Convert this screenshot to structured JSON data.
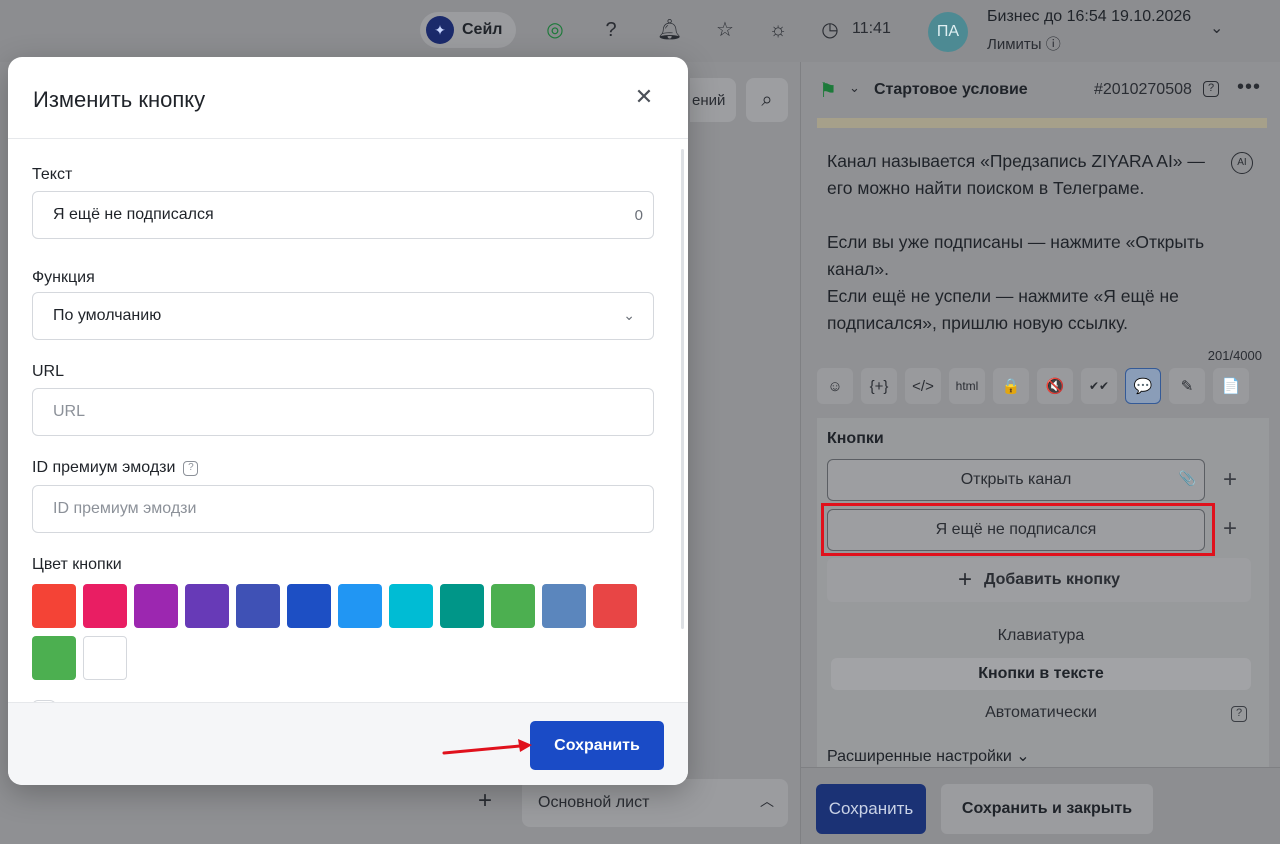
{
  "topbar": {
    "sale_label": "Сейл",
    "time": "11:41",
    "avatar_initials": "ПА",
    "business": "Бизнес до 16:54 19.10.2026",
    "limits": "Лимиты"
  },
  "middle": {
    "pill_text": "ений",
    "sheet_label": "Основной лист"
  },
  "right_panel": {
    "title": "Стартовое условие",
    "node_id": "#2010270508",
    "message": "Канал называется «Предзапись ZIYARA AI» — его можно найти поиском в Телеграме.\n\nЕсли вы уже подписаны — нажмите «Открыть канал».\nЕсли ещё не успели — нажмите «Я ещё не подписался», пришлю новую ссылку.",
    "ai_badge": "AI",
    "char_count": "201/4000",
    "toolbar": [
      "☺",
      "{+}",
      "</>",
      "html",
      "🔒",
      "🔇",
      "✔✔",
      "💬",
      "✎",
      "📄"
    ],
    "buttons_title": "Кнопки",
    "buttons": [
      "Открыть канал",
      "Я ещё не подписался"
    ],
    "add_button_label": "Добавить кнопку",
    "keyboard_options": [
      "Клавиатура",
      "Кнопки в тексте",
      "Автоматически"
    ],
    "keyboard_selected": "Кнопки в тексте",
    "advanced_label": "Расширенные настройки",
    "save_label": "Сохранить",
    "save_close_label": "Сохранить и закрыть"
  },
  "modal": {
    "title": "Изменить кнопку",
    "text_label": "Текст",
    "text_value": "Я ещё не подписался",
    "text_counter": "0",
    "function_label": "Функция",
    "function_value": "По умолчанию",
    "url_label": "URL",
    "url_placeholder": "URL",
    "emoji_label": "ID премиум эмодзи",
    "emoji_placeholder": "ID премиум эмодзи",
    "color_label": "Цвет кнопки",
    "colors": [
      "#f44336",
      "#e91e63",
      "#9c27b0",
      "#673ab7",
      "#3f51b5",
      "#1d4fc4",
      "#2196f3",
      "#00bcd4",
      "#009688",
      "#4caf50",
      "#5b86bd",
      "#e84545",
      "#4caf50",
      "#ffffff"
    ],
    "save_label": "Сохранить"
  }
}
